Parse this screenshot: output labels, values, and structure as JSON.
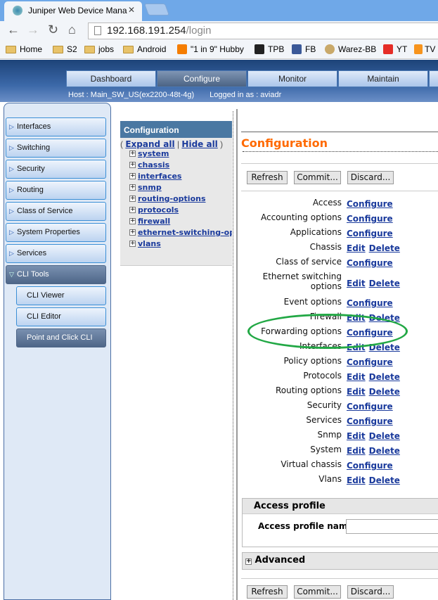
{
  "browser": {
    "tab_title": "Juniper Web Device Mana",
    "url_host": "192.168.191.254",
    "url_path": "/login",
    "bookmarks": [
      {
        "label": "Home",
        "icon": "folder-icon"
      },
      {
        "label": "S2",
        "icon": "folder-icon"
      },
      {
        "label": "jobs",
        "icon": "folder-icon"
      },
      {
        "label": "Android",
        "icon": "folder-icon"
      },
      {
        "label": "\"1 in 9\" Hubby",
        "icon": "blogger-icon",
        "color": "#f57d00"
      },
      {
        "label": "TPB",
        "icon": "pirate-icon",
        "color": "#222222"
      },
      {
        "label": "FB",
        "icon": "facebook-icon",
        "color": "#3b5998"
      },
      {
        "label": "Warez-BB",
        "icon": "shield-icon",
        "color": "#c9a96a"
      },
      {
        "label": "YT",
        "icon": "youtube-icon",
        "color": "#e52d27"
      },
      {
        "label": "TV",
        "icon": "tv-icon",
        "color": "#f7941d"
      }
    ]
  },
  "nav_tabs": [
    "Dashboard",
    "Configure",
    "Monitor",
    "Maintain"
  ],
  "host_info": {
    "host": "Host : Main_SW_US(ex2200-48t-4g)",
    "user": "Logged in as : aviadr"
  },
  "sidebar": {
    "items": [
      "Interfaces",
      "Switching",
      "Security",
      "Routing",
      "Class of Service",
      "System Properties",
      "Services",
      "CLI Tools"
    ],
    "subitems": [
      "CLI Viewer",
      "CLI Editor",
      "Point and Click CLI"
    ]
  },
  "tree": {
    "title": "Configuration",
    "expand_all": "Expand all",
    "hide_all": "Hide all",
    "items": [
      "system",
      "chassis",
      "interfaces",
      "snmp",
      "routing-options",
      "protocols",
      "firewall",
      "ethernet-switching-options",
      "vlans"
    ]
  },
  "main": {
    "title": "Configuration",
    "buttons": {
      "refresh": "Refresh",
      "commit": "Commit...",
      "discard": "Discard..."
    },
    "rows": [
      {
        "label": "Access",
        "links": [
          "Configure"
        ]
      },
      {
        "label": "Accounting options",
        "links": [
          "Configure"
        ]
      },
      {
        "label": "Applications",
        "links": [
          "Configure"
        ]
      },
      {
        "label": "Chassis",
        "links": [
          "Edit",
          "Delete"
        ]
      },
      {
        "label": "Class of service",
        "links": [
          "Configure"
        ]
      },
      {
        "label": "Ethernet switching options",
        "links": [
          "Edit",
          "Delete"
        ]
      },
      {
        "label": "Event options",
        "links": [
          "Configure"
        ]
      },
      {
        "label": "Firewall",
        "links": [
          "Edit",
          "Delete"
        ]
      },
      {
        "label": "Forwarding options",
        "links": [
          "Configure"
        ]
      },
      {
        "label": "Interfaces",
        "links": [
          "Edit",
          "Delete"
        ]
      },
      {
        "label": "Policy options",
        "links": [
          "Configure"
        ]
      },
      {
        "label": "Protocols",
        "links": [
          "Edit",
          "Delete"
        ]
      },
      {
        "label": "Routing options",
        "links": [
          "Edit",
          "Delete"
        ]
      },
      {
        "label": "Security",
        "links": [
          "Configure"
        ]
      },
      {
        "label": "Services",
        "links": [
          "Configure"
        ]
      },
      {
        "label": "Snmp",
        "links": [
          "Edit",
          "Delete"
        ]
      },
      {
        "label": "System",
        "links": [
          "Edit",
          "Delete"
        ]
      },
      {
        "label": "Virtual chassis",
        "links": [
          "Configure"
        ]
      },
      {
        "label": "Vlans",
        "links": [
          "Edit",
          "Delete"
        ]
      }
    ],
    "access_profile": {
      "title": "Access profile",
      "field_label": "Access profile name",
      "value": ""
    },
    "advanced": {
      "title": "Advanced"
    }
  },
  "annotation_color": "#22a845"
}
